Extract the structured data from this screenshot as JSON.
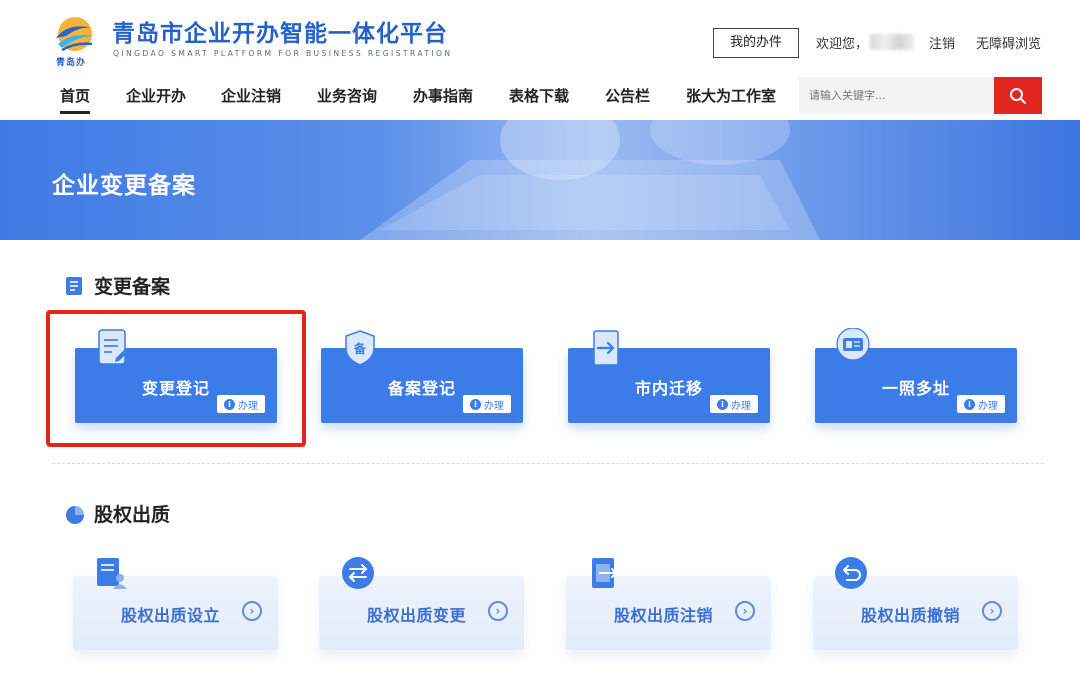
{
  "header": {
    "logo_text": "青岛办",
    "title": "青岛市企业开办智能一体化平台",
    "subtitle_en": "QINGDAO SMART PLATFORM FOR BUSINESS REGISTRATION",
    "my_affairs": "我的办件",
    "welcome": "欢迎您，",
    "logout": "注销",
    "accessible": "无障碍浏览"
  },
  "nav": {
    "items": [
      "首页",
      "企业开办",
      "企业注销",
      "业务咨询",
      "办事指南",
      "表格下载",
      "公告栏",
      "张大为工作室"
    ],
    "active_index": 0,
    "search_placeholder": "请输入关键字..."
  },
  "banner": {
    "title": "企业变更备案"
  },
  "sections": {
    "change": {
      "title": "变更备案",
      "cards": [
        {
          "label": "变更登记",
          "badge": "办理",
          "icon": "document-edit-icon"
        },
        {
          "label": "备案登记",
          "badge": "办理",
          "icon": "shield-icon"
        },
        {
          "label": "市内迁移",
          "badge": "办理",
          "icon": "transfer-door-icon"
        },
        {
          "label": "一照多址",
          "badge": "办理",
          "icon": "license-icon"
        }
      ],
      "shield_char": "备",
      "badge_icon_char": "i"
    },
    "equity": {
      "title": "股权出质",
      "cards": [
        {
          "label": "股权出质设立",
          "icon": "user-document-icon"
        },
        {
          "label": "股权出质变更",
          "icon": "swap-arrows-icon"
        },
        {
          "label": "股权出质注销",
          "icon": "exit-document-icon"
        },
        {
          "label": "股权出质撤销",
          "icon": "undo-icon"
        }
      ],
      "arrow_char": "›"
    }
  },
  "colors": {
    "brand_blue": "#2461c9",
    "card_blue": "#3b7ce8",
    "search_red": "#e0261f",
    "highlight_red": "#e8231c"
  }
}
